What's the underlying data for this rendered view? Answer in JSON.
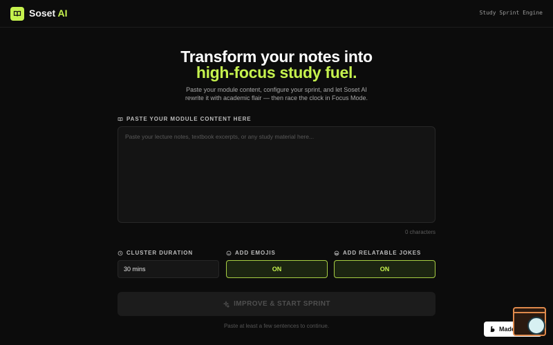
{
  "header": {
    "brand_main": "Soset",
    "brand_accent": "AI",
    "tagline": "Study Sprint Engine"
  },
  "hero": {
    "title_line1": "Transform your notes into",
    "title_line2": "high-focus study fuel.",
    "subtitle_line1": "Paste your module content, configure your sprint, and let Soset AI",
    "subtitle_line2": "rewrite it with academic flair — then race the clock in Focus Mode."
  },
  "content": {
    "label": "PASTE YOUR MODULE CONTENT HERE",
    "placeholder": "Paste your lecture notes, textbook excerpts, or any study material here...",
    "value": "",
    "char_count": "0 characters"
  },
  "options": {
    "duration": {
      "label": "CLUSTER DURATION",
      "value": "30 mins"
    },
    "emojis": {
      "label": "ADD EMOJIS",
      "value": "ON"
    },
    "jokes": {
      "label": "ADD RELATABLE JOKES",
      "value": "ON"
    }
  },
  "cta": {
    "label": "IMPROVE & START SPRINT",
    "hint": "Paste at least a few sentences to continue."
  },
  "badge": {
    "label": "Made in Bolt"
  },
  "colors": {
    "accent": "#c6f24e",
    "background": "#0c0c0c",
    "widget": "#e08a4c"
  }
}
